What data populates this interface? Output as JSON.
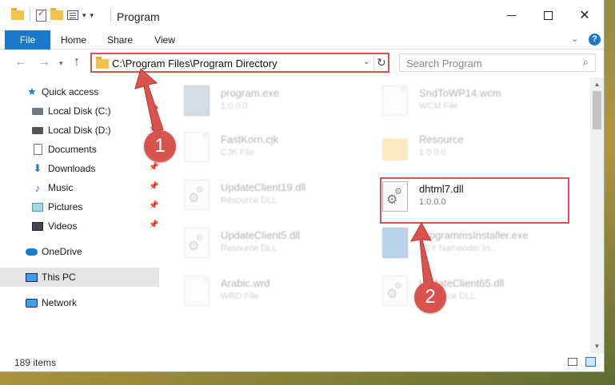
{
  "window": {
    "title": "Program",
    "tabs": {
      "file": "File",
      "home": "Home",
      "share": "Share",
      "view": "View"
    }
  },
  "nav": {
    "address": "C:\\Program Files\\Program Directory",
    "search_placeholder": "Search Program"
  },
  "sidebar": {
    "items": [
      {
        "label": "Quick access",
        "icon": "star-icon",
        "pinned": false
      },
      {
        "label": "Local Disk (C:)",
        "icon": "drive-icon",
        "pinned": true
      },
      {
        "label": "Local Disk (D:)",
        "icon": "drive-icon",
        "pinned": true
      },
      {
        "label": "Documents",
        "icon": "document-icon",
        "pinned": true
      },
      {
        "label": "Downloads",
        "icon": "download-icon",
        "pinned": true
      },
      {
        "label": "Music",
        "icon": "music-icon",
        "pinned": true
      },
      {
        "label": "Pictures",
        "icon": "pictures-icon",
        "pinned": true
      },
      {
        "label": "Videos",
        "icon": "videos-icon",
        "pinned": true
      },
      {
        "label": "OneDrive",
        "icon": "cloud-icon",
        "pinned": false
      },
      {
        "label": "This PC",
        "icon": "computer-icon",
        "pinned": false,
        "selected": true
      },
      {
        "label": "Network",
        "icon": "network-icon",
        "pinned": false
      }
    ]
  },
  "files": [
    {
      "name": "program.exe",
      "type": "1.0.0.0",
      "icon": "exe-icon"
    },
    {
      "name": "SndToWP14.wcm",
      "type": "WCM File",
      "icon": "document-icon"
    },
    {
      "name": "FastKorn.cjk",
      "type": "CJK File",
      "icon": "document-icon"
    },
    {
      "name": "Resource",
      "type": "1.0.0.0",
      "icon": "folder-icon"
    },
    {
      "name": "UpdateClient19.dll",
      "type": "Resource DLL",
      "icon": "gear-file-icon"
    },
    {
      "name": "dhtml7.dll",
      "type": "1.0.0.0",
      "icon": "gear-file-icon",
      "highlighted": true
    },
    {
      "name": "UpdateClient5.dll",
      "type": "Resource DLL",
      "icon": "gear-file-icon"
    },
    {
      "name": "ProgrammsInstaller.exe",
      "type": "KEY Nameoder In...",
      "icon": "installer-icon"
    },
    {
      "name": "Arabic.wrd",
      "type": "WRD File",
      "icon": "document-icon"
    },
    {
      "name": "UpdateClient65.dll",
      "type": "Resource DLL",
      "icon": "gear-file-icon"
    }
  ],
  "status": {
    "item_count": "189 items"
  },
  "annotations": {
    "step1": "1",
    "step2": "2"
  },
  "colors": {
    "accent": "#1979ca",
    "annotation": "#d9534f",
    "selection": "#e5e5e5"
  }
}
